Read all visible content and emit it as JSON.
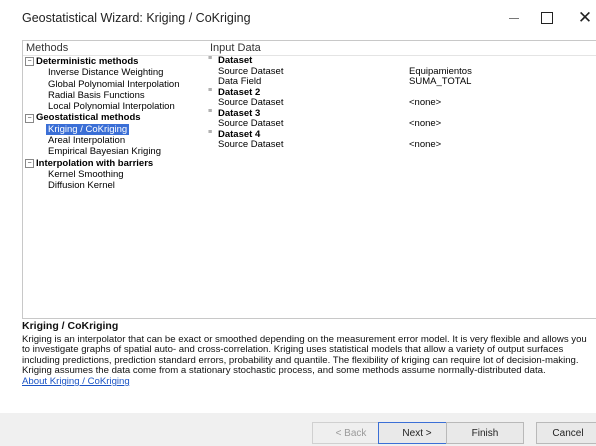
{
  "window": {
    "title": "Geostatistical Wizard: Kriging / CoKriging",
    "minimize_icon": "minimize-icon",
    "maximize_icon": "maximize-icon",
    "close_icon": "close-icon",
    "close_glyph": "✕"
  },
  "methods": {
    "header": "Methods",
    "groups": [
      {
        "label": "Deterministic methods",
        "toggle": "−",
        "items": [
          "Inverse Distance Weighting",
          "Global Polynomial Interpolation",
          "Radial Basis Functions",
          "Local Polynomial Interpolation"
        ]
      },
      {
        "label": "Geostatistical methods",
        "toggle": "−",
        "items": [
          "Kriging / CoKriging",
          "Areal Interpolation",
          "Empirical Bayesian Kriging"
        ]
      },
      {
        "label": "Interpolation with barriers",
        "toggle": "−",
        "items": [
          "Kernel Smoothing",
          "Diffusion Kernel"
        ]
      }
    ],
    "selected": "Kriging / CoKriging"
  },
  "input_data": {
    "header": "Input Data",
    "collapse_glyph": "≡",
    "sections": [
      {
        "label": "Dataset",
        "rows": [
          {
            "key": "Source Dataset",
            "value": "Equipamientos"
          },
          {
            "key": "Data Field",
            "value": "SUMA_TOTAL"
          }
        ]
      },
      {
        "label": "Dataset 2",
        "rows": [
          {
            "key": "Source Dataset",
            "value": "<none>"
          }
        ]
      },
      {
        "label": "Dataset 3",
        "rows": [
          {
            "key": "Source Dataset",
            "value": "<none>"
          }
        ]
      },
      {
        "label": "Dataset 4",
        "rows": [
          {
            "key": "Source Dataset",
            "value": "<none>"
          }
        ]
      }
    ]
  },
  "description": {
    "title": "Kriging / CoKriging",
    "text": "Kriging is an interpolator that can be exact or smoothed depending on the measurement error model. It is very flexible and allows you to investigate graphs of spatial auto- and cross-correlation. Kriging uses statistical models that allow a variety of output surfaces including predictions, prediction standard errors, probability and quantile. The flexibility of kriging can require lot of decision-making. Kriging assumes the data come from a stationary stochastic process, and some methods assume normally-distributed data.",
    "link": "About Kriging / CoKriging"
  },
  "buttons": {
    "back": "< Back",
    "next": "Next >",
    "finish": "Finish",
    "cancel": "Cancel"
  }
}
